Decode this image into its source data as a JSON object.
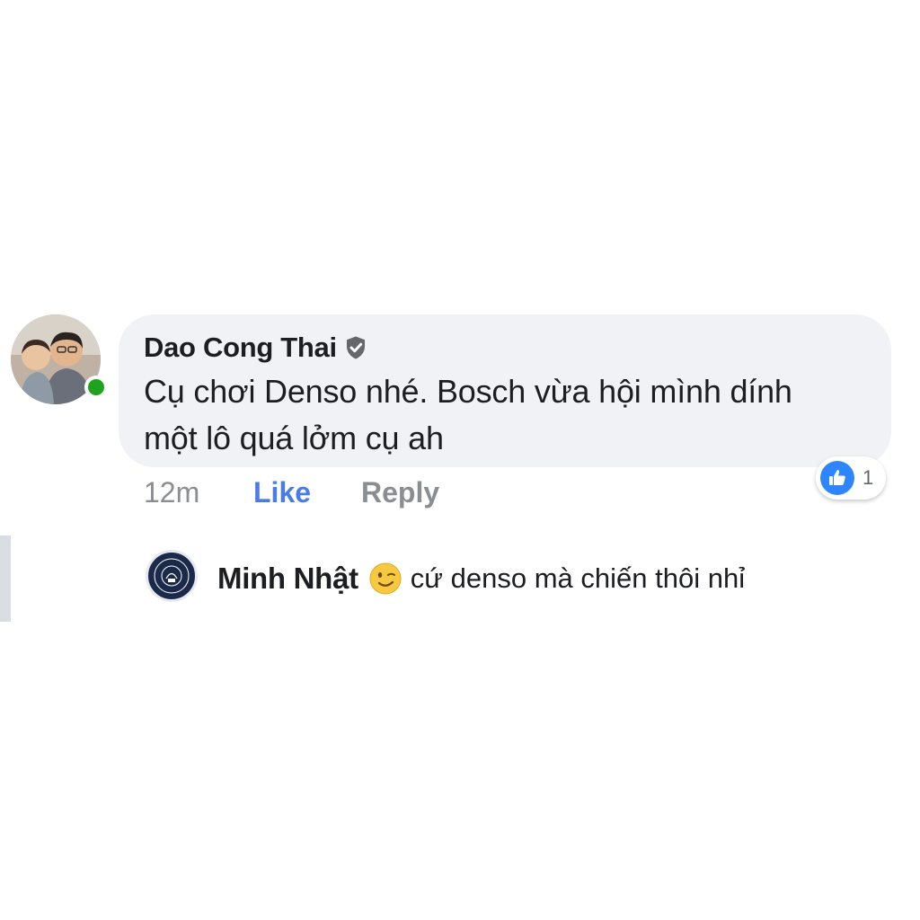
{
  "comment": {
    "author": "Dao Cong Thai",
    "text_line1": "Cụ chơi Denso nhé. Bosch vừa hội mình dính",
    "text_line2": "một lô quá lởm cụ ah",
    "time": "12m",
    "like_label": "Like",
    "reply_label": "Reply",
    "reaction_count": "1",
    "reaction_icon": "thumbs-up-icon",
    "verified_icon": "shield-check-icon",
    "online": true
  },
  "reply": {
    "author": "Minh Nhật",
    "emoji_icon": "wink-emoji-icon",
    "text": "cứ denso mà chiến thôi nhỉ"
  },
  "colors": {
    "bubble": "#f0f2f5",
    "like_blue": "#4a7ce8",
    "reaction_blue": "#2d86ff",
    "online_green": "#1fa31f",
    "muted": "#8a8d91"
  }
}
